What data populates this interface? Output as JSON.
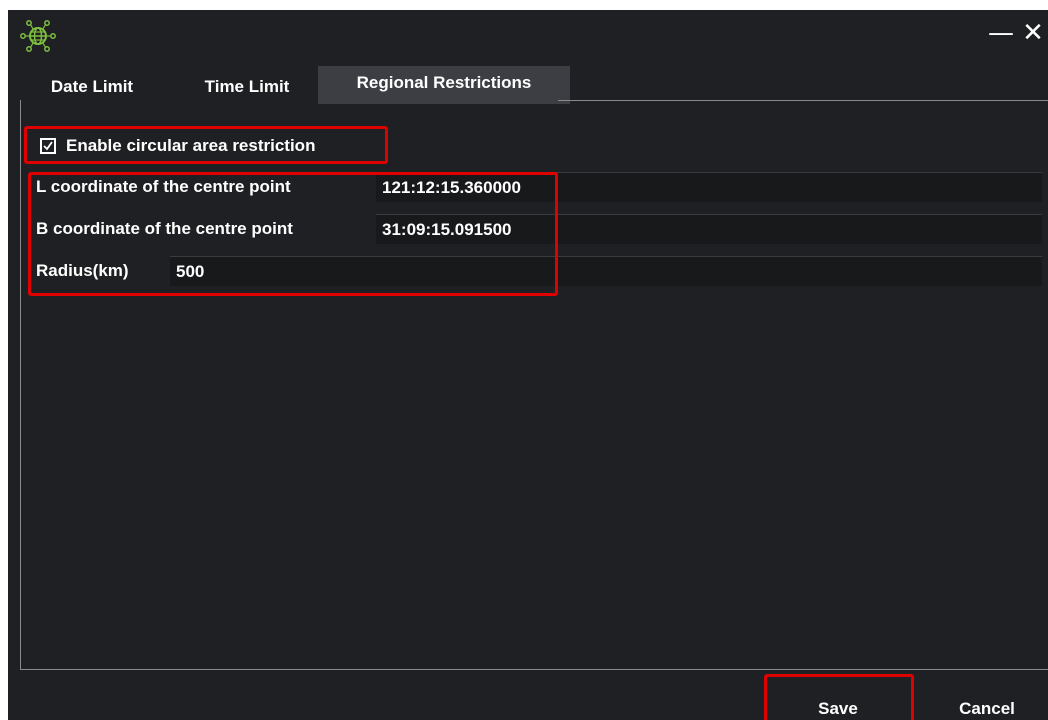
{
  "window": {
    "icon": "globe-network-icon",
    "controls": {
      "minimize_label": "—",
      "close_label": "✕"
    }
  },
  "tabs": [
    {
      "label": "Date Limit",
      "active": false
    },
    {
      "label": "Time Limit",
      "active": false
    },
    {
      "label": "Regional Restrictions",
      "active": true
    }
  ],
  "restriction": {
    "checkbox_label": "Enable circular area restriction",
    "checked": true,
    "fields": {
      "l_label": "L coordinate of the centre point",
      "l_value": "121:12:15.360000",
      "b_label": "B coordinate of the centre point",
      "b_value": "31:09:15.091500",
      "radius_label": "Radius(km)",
      "radius_value": "500"
    }
  },
  "footer": {
    "save_label": "Save",
    "cancel_label": "Cancel"
  },
  "colors": {
    "background": "#1f2023",
    "active_tab": "#3c3e44",
    "highlight": "#e00000",
    "icon_green": "#7fbf3f"
  }
}
